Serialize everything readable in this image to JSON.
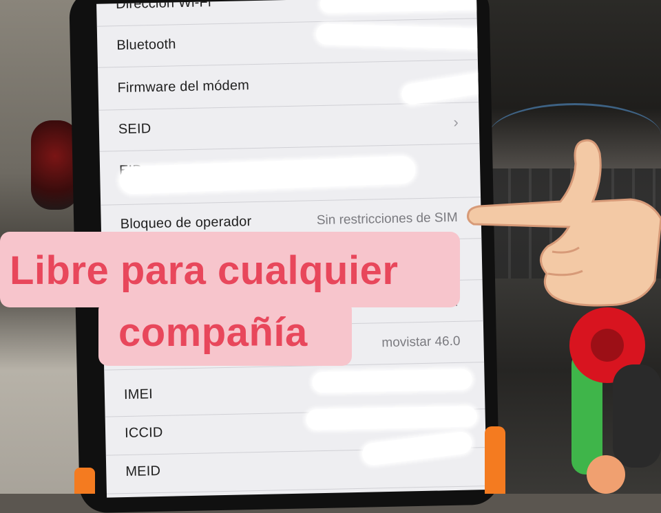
{
  "settings_rows": [
    {
      "label": "Dirección Wi-Fi",
      "value": ""
    },
    {
      "label": "Bluetooth",
      "value": ""
    },
    {
      "label": "Firmware del módem",
      "value": ""
    },
    {
      "label": "SEID",
      "value": ""
    },
    {
      "label": "EID",
      "value": ""
    },
    {
      "label": "Bloqueo de operador",
      "value": "Sin restricciones de SIM"
    },
    {
      "label": "",
      "value": ""
    },
    {
      "label": "",
      "value": "Movistar"
    },
    {
      "label": "",
      "value": "movistar 46.0"
    },
    {
      "label": "IMEI",
      "value": ""
    },
    {
      "label": "ICCID",
      "value": ""
    },
    {
      "label": "MEID",
      "value": ""
    }
  ],
  "overlay": {
    "line1": "Libre para cualquier",
    "line2": "compañía",
    "background_color": "#f7c5cc",
    "text_color": "#e8475b"
  },
  "icons": {
    "chevron": "chevron-right-icon",
    "hand": "pointing-left-hand-icon"
  }
}
